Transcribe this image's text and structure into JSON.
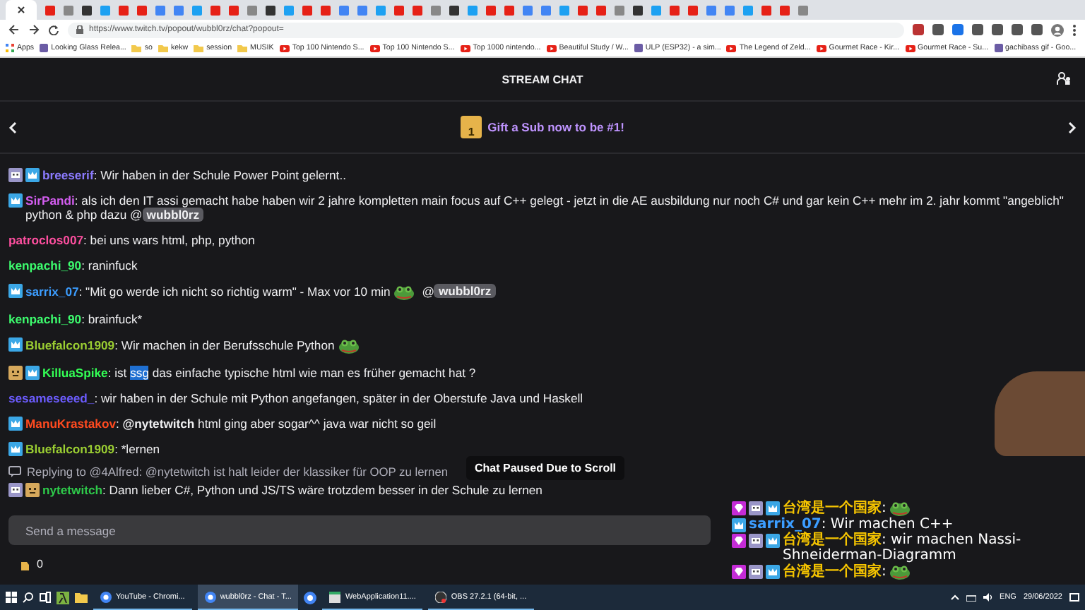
{
  "browser": {
    "url": "https://www.twitch.tv/popout/wubbl0rz/chat?popout=",
    "bookmarks": [
      {
        "label": "Apps",
        "kind": "apps"
      },
      {
        "label": "Looking Glass Relea...",
        "kind": "site"
      },
      {
        "label": "so",
        "kind": "folder"
      },
      {
        "label": "kekw",
        "kind": "folder"
      },
      {
        "label": "session",
        "kind": "folder"
      },
      {
        "label": "MUSIK",
        "kind": "folder"
      },
      {
        "label": "Top 100 Nintendo S...",
        "kind": "video"
      },
      {
        "label": "Top 100 Nintendo S...",
        "kind": "video"
      },
      {
        "label": "Top 1000 nintendo...",
        "kind": "video"
      },
      {
        "label": "Beautiful Study / W...",
        "kind": "video"
      },
      {
        "label": "ULP (ESP32) - a sim...",
        "kind": "site"
      },
      {
        "label": "The Legend of Zeld...",
        "kind": "video"
      },
      {
        "label": "Gourmet Race - Kir...",
        "kind": "video"
      },
      {
        "label": "Gourmet Race - Su...",
        "kind": "video"
      },
      {
        "label": "gachibass gif - Goo...",
        "kind": "site"
      }
    ]
  },
  "chat": {
    "title": "STREAM CHAT",
    "banner": {
      "gift_number": "1",
      "text": "Gift a Sub now to be #1!"
    },
    "messages": [
      {
        "kind": "message",
        "badges": [
          {
            "kind": "bot"
          },
          {
            "kind": "sub"
          }
        ],
        "user": "breeserif",
        "color": "#8c7bff",
        "segments": [
          {
            "kind": "text",
            "text": ": Wir haben in der Schule Power Point gelernt.."
          }
        ]
      },
      {
        "kind": "message",
        "badges": [
          {
            "kind": "sub"
          }
        ],
        "user": "SirPandi",
        "color": "#d35df0",
        "segments": [
          {
            "kind": "text",
            "text": ": als ich den IT assi gemacht habe haben wir 2 jahre kompletten main focus auf C++ gelegt - jetzt in die AE ausbildung nur noch C# und gar kein C++ mehr im 2. jahr kommt \"angeblich\" python & php dazu @"
          },
          {
            "kind": "mention",
            "text": "wubbl0rz"
          }
        ]
      },
      {
        "kind": "message",
        "user": "patroclos007",
        "color": "#ff4fa0",
        "segments": [
          {
            "kind": "text",
            "text": ": bei uns wars html, php, python"
          }
        ]
      },
      {
        "kind": "message",
        "user": "kenpachi_90",
        "color": "#3dfc6e",
        "segments": [
          {
            "kind": "text",
            "text": ": raninfuck"
          }
        ]
      },
      {
        "kind": "message",
        "badges": [
          {
            "kind": "sub"
          }
        ],
        "user": "sarrix_07",
        "color": "#3c9dff",
        "segments": [
          {
            "kind": "text",
            "text": ": \"Mit go werde ich nicht so richtig warm\" - Max vor 10 min"
          },
          {
            "kind": "emote"
          },
          {
            "kind": "text",
            "text": " @"
          },
          {
            "kind": "mention",
            "text": "wubbl0rz"
          }
        ]
      },
      {
        "kind": "message",
        "user": "kenpachi_90",
        "color": "#3dfc6e",
        "segments": [
          {
            "kind": "text",
            "text": ": brainfuck*"
          }
        ]
      },
      {
        "kind": "message",
        "badges": [
          {
            "kind": "sub"
          }
        ],
        "user": "Bluefalcon1909",
        "color": "#9acd32",
        "segments": [
          {
            "kind": "text",
            "text": ": Wir machen in der Berufsschule Python"
          },
          {
            "kind": "emote"
          }
        ]
      },
      {
        "kind": "message",
        "badges": [
          {
            "kind": "custom"
          },
          {
            "kind": "sub"
          }
        ],
        "user": "KilluaSpike",
        "color": "#33ff55",
        "segments": [
          {
            "kind": "text",
            "text": ": ist "
          },
          {
            "kind": "highlight",
            "text": "ssg"
          },
          {
            "kind": "text",
            "text": " das einfache typische html wie man es früher gemacht hat ?"
          }
        ]
      },
      {
        "kind": "message",
        "user": "sesameseeed_",
        "color": "#6c5cff",
        "segments": [
          {
            "kind": "text",
            "text": ": wir haben in der Schule mit Python angefangen, später in der Oberstufe Java und Haskell"
          }
        ]
      },
      {
        "kind": "message",
        "badges": [
          {
            "kind": "sub"
          }
        ],
        "user": "ManuKrastakov",
        "color": "#ff4a1f",
        "segments": [
          {
            "kind": "text",
            "text": ": "
          },
          {
            "kind": "bold",
            "text": "@nytetwitch"
          },
          {
            "kind": "text",
            "text": " html ging aber sogar^^ java war nicht so geil"
          }
        ]
      },
      {
        "kind": "message",
        "badges": [
          {
            "kind": "sub"
          }
        ],
        "user": "Bluefalcon1909",
        "color": "#9acd32",
        "segments": [
          {
            "kind": "text",
            "text": ": *lernen"
          }
        ]
      },
      {
        "kind": "reply",
        "text": "Replying to @4Alfred: @nytetwitch ist halt leider der klassiker für OOP zu lernen"
      },
      {
        "kind": "message",
        "badges": [
          {
            "kind": "bot"
          },
          {
            "kind": "custom"
          }
        ],
        "user": "nytetwitch",
        "color": "#2ec94a",
        "segments": [
          {
            "kind": "text",
            "text": ": Dann lieber C#, Python und JS/TS wäre trotzdem besser in der Schule zu lernen"
          }
        ]
      }
    ],
    "paused_notice": "Chat Paused Due to Scroll",
    "input": {
      "placeholder": "Send a message"
    },
    "points": "0"
  },
  "overlay": {
    "messages": [
      {
        "badges": [
          {
            "kind": "gem"
          },
          {
            "kind": "bot"
          },
          {
            "kind": "sub"
          }
        ],
        "user": "台湾是一个国家",
        "color": "#f5c400",
        "segments": [
          {
            "kind": "text",
            "text": ":"
          },
          {
            "kind": "emote"
          }
        ]
      },
      {
        "badges": [
          {
            "kind": "sub"
          }
        ],
        "user": "sarrix_07",
        "color": "#3c9dff",
        "segments": [
          {
            "kind": "text",
            "text": ": Wir machen C++"
          }
        ]
      },
      {
        "badges": [
          {
            "kind": "gem"
          },
          {
            "kind": "bot"
          },
          {
            "kind": "sub"
          }
        ],
        "user": "台湾是一个国家",
        "color": "#f5c400",
        "segments": [
          {
            "kind": "text",
            "text": ": wir machen Nassi-Shneiderman-Diagramm"
          }
        ]
      },
      {
        "badges": [
          {
            "kind": "gem"
          },
          {
            "kind": "bot"
          },
          {
            "kind": "sub"
          }
        ],
        "user": "台湾是一个国家",
        "color": "#f5c400",
        "segments": [
          {
            "kind": "text",
            "text": ":"
          },
          {
            "kind": "emote"
          }
        ]
      }
    ]
  },
  "taskbar": {
    "apps": [
      {
        "label": "YouTube - Chromi...",
        "selected": false
      },
      {
        "label": "wubbl0rz - Chat - T...",
        "selected": true
      },
      {
        "label": "WebApplication11....",
        "selected": false
      },
      {
        "label": "OBS 27.2.1 (64-bit, ...",
        "selected": false
      }
    ],
    "language": "ENG",
    "date": "29/06/2022"
  }
}
